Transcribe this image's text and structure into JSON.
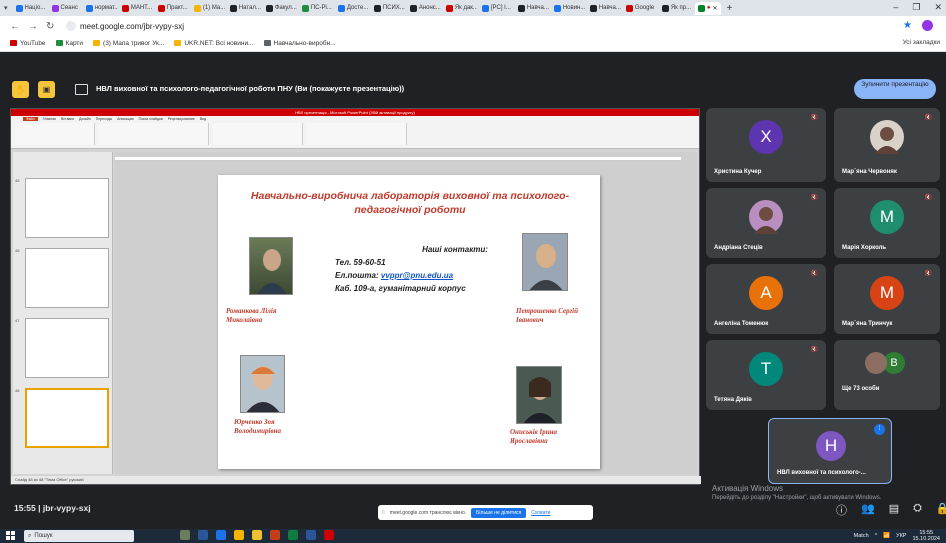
{
  "browser": {
    "tabs": [
      {
        "label": "Націо...",
        "color": "#1a73e8"
      },
      {
        "label": "Сеанс",
        "color": "#9334e6"
      },
      {
        "label": "нормат...",
        "color": "#1a73e8"
      },
      {
        "label": "МАНТ...",
        "color": "#c00"
      },
      {
        "label": "Практ...",
        "color": "#c00"
      },
      {
        "label": "(1) Ма...",
        "color": "#f4b400"
      },
      {
        "label": "Натал...",
        "color": "#202124"
      },
      {
        "label": "Факул...",
        "color": "#202124"
      },
      {
        "label": "ПС-Рі...",
        "color": "#1e8e3e"
      },
      {
        "label": "Досте...",
        "color": "#1a73e8"
      },
      {
        "label": "ПСИХ...",
        "color": "#202124"
      },
      {
        "label": "Анонс...",
        "color": "#202124"
      },
      {
        "label": "Як дак...",
        "color": "#c00"
      },
      {
        "label": "[PC] І...",
        "color": "#1a73e8"
      },
      {
        "label": "Навча...",
        "color": "#202124"
      },
      {
        "label": "Новин...",
        "color": "#1a73e8"
      },
      {
        "label": "Навча...",
        "color": "#202124"
      },
      {
        "label": "Google",
        "color": "#c00"
      },
      {
        "label": "Як пр...",
        "color": "#202124"
      }
    ],
    "url": "meet.google.com/jbr-vypy-sxj",
    "bookmarks": [
      {
        "label": "YouTube",
        "color": "#c00"
      },
      {
        "label": "Карти",
        "color": "#1e8e3e"
      },
      {
        "label": "(3) Мапа тривог Ук...",
        "color": "#f4b400"
      },
      {
        "label": "UKR.NET: Всі новини...",
        "color": "#f4b400"
      },
      {
        "label": "Навчально-виробн...",
        "color": "#5f6368"
      }
    ],
    "all_bookmarks": "Усі закладки"
  },
  "meet": {
    "presenting_title": "НВЛ виховної та психолого-педагогічної роботи ПНУ (Ви (покажуєте презентацію))",
    "stop_button": "Зупинити презентацію",
    "time": "15:55",
    "meeting_code": "jbr-vypy-sxj",
    "share_bar": {
      "text": "meet.google.com транслює вікно.",
      "share_button": "Більше не ділитися",
      "hide_link": "Сховати"
    },
    "participants": [
      {
        "name": "Христина Кучер",
        "initial": "X",
        "color": "#5e35b1"
      },
      {
        "name": "Мар`яна Червоняк",
        "initial": "",
        "color": ""
      },
      {
        "name": "Андріана Стеців",
        "initial": "",
        "color": ""
      },
      {
        "name": "Марія Хорколь",
        "initial": "M",
        "color": "#1e8e6e"
      },
      {
        "name": "Ангеліна Томенюк",
        "initial": "A",
        "color": "#e8710a"
      },
      {
        "name": "Мар`яна Тринчук",
        "initial": "M",
        "color": "#d84315"
      },
      {
        "name": "Тетяна Дяків",
        "initial": "T",
        "color": "#00897b"
      },
      {
        "name": "Ще 73 особи",
        "initial": "B",
        "color": "#2e7d32"
      },
      {
        "name": "НВЛ виховної та психолого-...",
        "initial": "H",
        "color": "#7e57c2"
      }
    ]
  },
  "powerpoint": {
    "window_title": "НВЛ презентація - Microsoft PowerPoint (Збій активації продукту)",
    "ribbon_tabs": [
      "Файл",
      "Главная",
      "Вставка",
      "Дизайн",
      "Переходы",
      "Анимация",
      "Показ слайдов",
      "Рецензирование",
      "Вид"
    ],
    "status_text": "Слайд 48 из 48   \"Тема Office\"   русский",
    "slide_title": "Навчально-виробнича лабораторія виховної та психолого-педагогічної роботи",
    "contacts_header": "Наші контакти:",
    "phone": "Тел. 59-60-51",
    "email_label": "Ел.пошта: ",
    "email": "vvppr@pnu.edu.ua",
    "office": "Каб. 109-а, гуманітарний корпус",
    "people": [
      {
        "name": "Романкова Лілія Миколаївна"
      },
      {
        "name": "Петрошенко Сергій Іванович"
      },
      {
        "name": "Юрченко Зоя Володимирівна"
      },
      {
        "name": "Ониськів Ірина Ярославівна"
      }
    ]
  },
  "windows": {
    "activation_title": "Активація Windows",
    "activation_sub": "Перейдіть до розділу \"Настройки\", щоб активувати Windows.",
    "search_placeholder": "Пошук",
    "tray_match": "Match",
    "tray_lang": "УКР",
    "tray_time": "15:55",
    "tray_date": "15.10.2024"
  }
}
